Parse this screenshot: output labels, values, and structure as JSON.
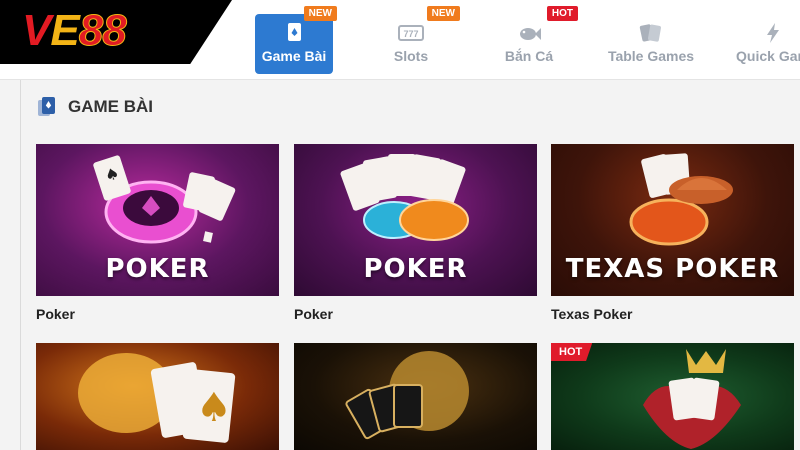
{
  "brand": {
    "logo_text": "VE88"
  },
  "nav": {
    "items": [
      {
        "label": "Game Bài",
        "badge": "NEW",
        "badge_type": "new",
        "active": true,
        "icon": "cards-icon"
      },
      {
        "label": "Slots",
        "badge": "NEW",
        "badge_type": "new",
        "active": false,
        "icon": "slot-machine-icon"
      },
      {
        "label": "Bắn Cá",
        "badge": "HOT",
        "badge_type": "hot",
        "active": false,
        "icon": "fish-icon"
      },
      {
        "label": "Table Games",
        "badge": "",
        "badge_type": "",
        "active": false,
        "icon": "table-cards-icon"
      },
      {
        "label": "Quick Gam",
        "badge": "",
        "badge_type": "",
        "active": false,
        "icon": "lightning-icon"
      }
    ]
  },
  "section": {
    "title": "GAME BÀI",
    "icon": "cards-icon"
  },
  "games": [
    {
      "caption": "Poker",
      "art_title": "POKER",
      "bg": "purple"
    },
    {
      "caption": "Poker",
      "art_title": "POKER",
      "bg": "purple"
    },
    {
      "caption": "Texas Poker",
      "art_title": "TEXAS POKER",
      "bg": "red"
    },
    {
      "caption": "",
      "art_title": "",
      "bg": "orange"
    },
    {
      "caption": "",
      "art_title": "",
      "bg": "dark"
    },
    {
      "caption": "",
      "art_title": "",
      "bg": "green",
      "tag": "HOT"
    }
  ],
  "colors": {
    "accent": "#2d7ad1",
    "new_badge": "#f07b1d",
    "hot_badge": "#e01b2b"
  }
}
